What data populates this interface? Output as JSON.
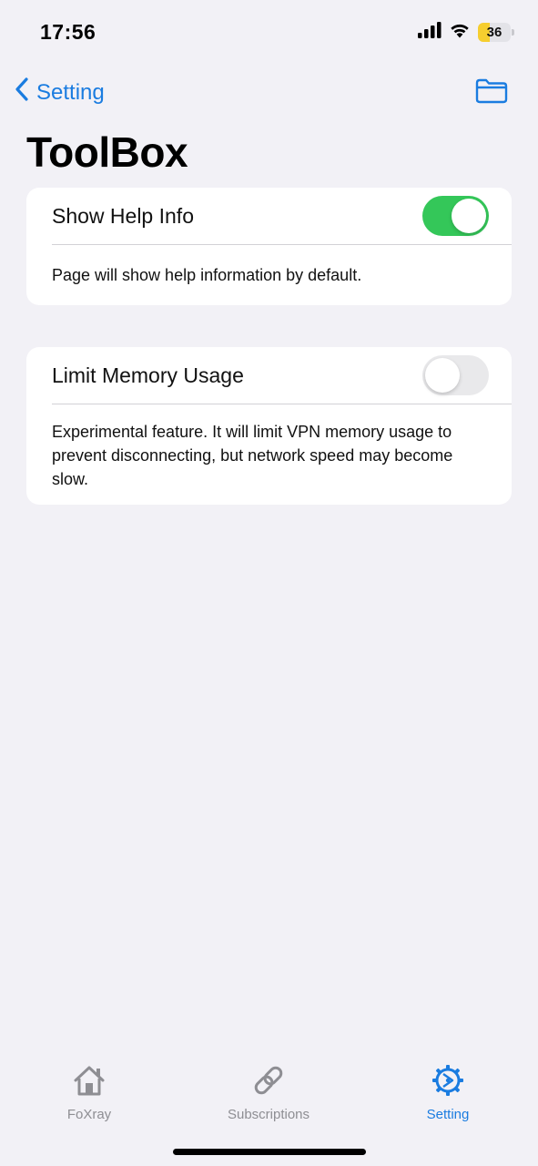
{
  "status_bar": {
    "time": "17:56",
    "battery_level": "36",
    "battery_fraction": 0.36,
    "icons": [
      "cellular-signal-icon",
      "wifi-icon",
      "battery-icon"
    ]
  },
  "nav": {
    "back_label": "Setting",
    "back_icon": "chevron-left-icon",
    "action_icon": "folder-icon",
    "accent_color": "#1a7ce0"
  },
  "page": {
    "title": "ToolBox"
  },
  "settings": [
    {
      "label": "Show Help Info",
      "enabled": true,
      "description": "Page will show help information by default."
    },
    {
      "label": "Limit Memory Usage",
      "enabled": false,
      "description": "Experimental feature. It will limit VPN memory usage to prevent disconnecting, but network speed may become slow."
    }
  ],
  "toggle_on_color": "#34c759",
  "tabs": [
    {
      "label": "FoXray",
      "icon": "home-icon",
      "active": false
    },
    {
      "label": "Subscriptions",
      "icon": "link-icon",
      "active": false
    },
    {
      "label": "Setting",
      "icon": "gear-icon",
      "active": true
    }
  ]
}
